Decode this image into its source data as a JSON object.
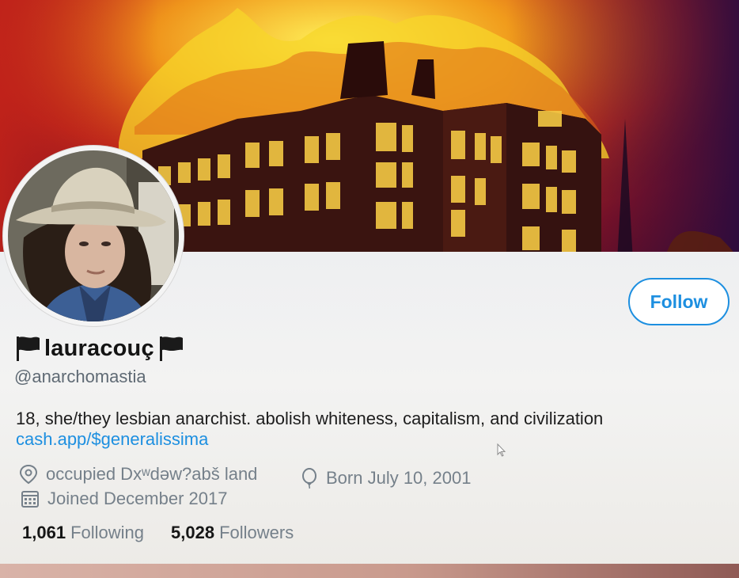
{
  "profile": {
    "display_name": "lauracouç",
    "handle": "@anarchomastia",
    "bio": "18, she/they lesbian anarchist. abolish whiteness, capitalism, and civilization",
    "bio_link": "cash.app/$generalissima",
    "location": "occupied Dxʷdəw?abš land",
    "birthday": "Born July 10, 2001",
    "joined": "Joined December 2017",
    "following_count": "1,061",
    "following_label": "Following",
    "followers_count": "5,028",
    "followers_label": "Followers"
  },
  "actions": {
    "follow_label": "Follow"
  },
  "icons": {
    "name_left": "black-flag-icon",
    "name_right": "black-flag-icon",
    "location": "location-pin-icon",
    "birthday": "balloon-icon",
    "joined": "calendar-icon",
    "cursor": "mouse-cursor-icon"
  },
  "colors": {
    "accent": "#1d8fe0",
    "text_primary": "#141414",
    "text_secondary": "#75808a"
  }
}
